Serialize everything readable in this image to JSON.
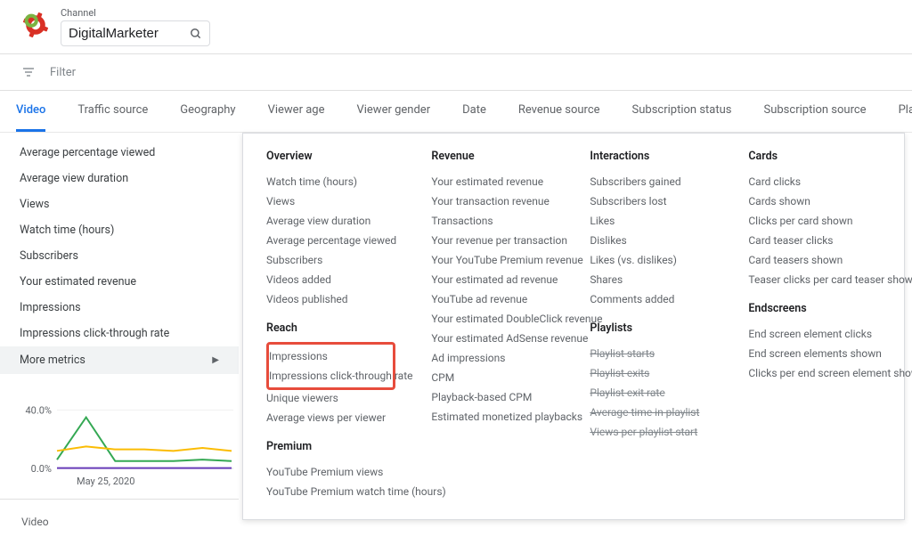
{
  "channel_label": "Channel",
  "channel_value": "DigitalMarketer",
  "filter_placeholder": "Filter",
  "tabs": [
    {
      "label": "Video",
      "active": true
    },
    {
      "label": "Traffic source"
    },
    {
      "label": "Geography"
    },
    {
      "label": "Viewer age"
    },
    {
      "label": "Viewer gender"
    },
    {
      "label": "Date"
    },
    {
      "label": "Revenue source"
    },
    {
      "label": "Subscription status"
    },
    {
      "label": "Subscription source"
    },
    {
      "label": "Playlist"
    }
  ],
  "left_metrics": [
    "Average percentage viewed",
    "Average view duration",
    "Views",
    "Watch time (hours)",
    "Subscribers",
    "Your estimated revenue",
    "Impressions",
    "Impressions click-through rate"
  ],
  "more_metrics_label": "More metrics",
  "video_label": "Video",
  "panel": {
    "col1": {
      "overview": {
        "title": "Overview",
        "items": [
          "Watch time (hours)",
          "Views",
          "Average view duration",
          "Average percentage viewed",
          "Subscribers",
          "Videos added",
          "Videos published"
        ]
      },
      "reach": {
        "title": "Reach",
        "items_boxed": [
          "Impressions",
          "Impressions click-through rate"
        ],
        "items": [
          "Unique viewers",
          "Average views per viewer"
        ]
      },
      "premium": {
        "title": "Premium",
        "items": [
          "YouTube Premium views",
          "YouTube Premium watch time (hours)"
        ]
      }
    },
    "col2": {
      "revenue": {
        "title": "Revenue",
        "items": [
          "Your estimated revenue",
          "Your transaction revenue",
          "Transactions",
          "Your revenue per transaction",
          "Your YouTube Premium revenue",
          "Your estimated ad revenue",
          "YouTube ad revenue",
          "Your estimated DoubleClick revenue",
          "Your estimated AdSense revenue",
          "Ad impressions",
          "CPM",
          "Playback-based CPM",
          "Estimated monetized playbacks"
        ]
      }
    },
    "col3": {
      "interactions": {
        "title": "Interactions",
        "items": [
          "Subscribers gained",
          "Subscribers lost",
          "Likes",
          "Dislikes",
          "Likes (vs. dislikes)",
          "Shares",
          "Comments added"
        ]
      },
      "playlists": {
        "title": "Playlists",
        "items_strike": [
          "Playlist starts",
          "Playlist exits",
          "Playlist exit rate",
          "Average time in playlist",
          "Views per playlist start"
        ]
      }
    },
    "col4": {
      "cards": {
        "title": "Cards",
        "items": [
          "Card clicks",
          "Cards shown",
          "Clicks per card shown",
          "Card teaser clicks",
          "Card teasers shown",
          "Teaser clicks per card teaser shown"
        ]
      },
      "endscreens": {
        "title": "Endscreens",
        "items": [
          "End screen element clicks",
          "End screen elements shown",
          "Clicks per end screen element shown"
        ]
      }
    }
  },
  "chart_data": {
    "type": "line",
    "x_tick_label": "May 25, 2020",
    "y_ticks": [
      "0.0%",
      "40.0%"
    ],
    "ylim": [
      0,
      50
    ],
    "series": [
      {
        "name": "green",
        "color": "#34a853",
        "values": [
          6,
          35,
          5,
          5,
          5,
          6,
          5
        ]
      },
      {
        "name": "orange",
        "color": "#fbbc04",
        "values": [
          12,
          15,
          13,
          13,
          12,
          14,
          12
        ]
      },
      {
        "name": "purple",
        "color": "#673ab7",
        "values": [
          0.2,
          0.2,
          0.2,
          0.2,
          0.2,
          0.2,
          0.2
        ]
      }
    ]
  }
}
